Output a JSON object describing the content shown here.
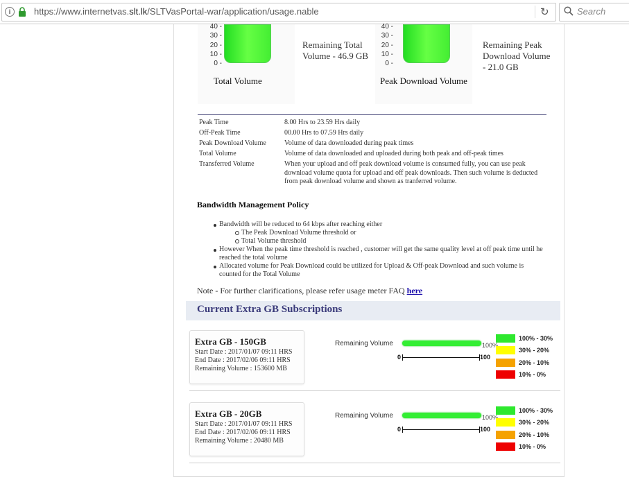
{
  "browser": {
    "url_prefix": "https://www.internetvas.",
    "url_domain": "slt.lk",
    "url_path": "/SLTVasPortal-war/application/usage.nable",
    "search_placeholder": "Search"
  },
  "gauges": [
    {
      "title": "Total Volume",
      "ticks": [
        "40 -",
        "30 -",
        "20 -",
        "10 -",
        "0 -"
      ],
      "remaining": "Remaining Total Volume - 46.9 GB"
    },
    {
      "title": "Peak Download Volume",
      "ticks": [
        "40 -",
        "30 -",
        "20 -",
        "10 -",
        "0 -"
      ],
      "remaining": "Remaining Peak Download Volume - 21.0 GB"
    }
  ],
  "definitions": [
    {
      "term": "Peak Time",
      "desc": "8.00 Hrs to 23.59 Hrs daily"
    },
    {
      "term": "Off-Peak Time",
      "desc": "00.00 Hrs to 07.59 Hrs daily"
    },
    {
      "term": "Peak Download Volume",
      "desc": "Volume of data downloaded during peak times"
    },
    {
      "term": "Total Volume",
      "desc": "Volume of data downloaded and uploaded during both peak and off-peak times"
    },
    {
      "term": "Transferred Volume",
      "desc": "When your upload and off peak download volume is consumed fully, you can use peak download volume quota for upload and off peak downloads. Then such volume is deducted from peak download volume and shown as tranferred volume."
    }
  ],
  "policy": {
    "title": "Bandwidth Management Policy",
    "b1": "Bandwidth will be reduced to 64 kbps after reaching either",
    "b1a": "The Peak Download Volume threshold or",
    "b1b": "Total Volume threshold",
    "b2": "However When the peak time threshold is reached , customer will get the same quality level at off peak time until he reached the total volume",
    "b3": "Allocated volume for Peak Download could be utilized for Upload & Off-peak Download and such volume is counted for the Total Volume"
  },
  "note": {
    "text": "Note - For further clarifications, please refer usage meter FAQ ",
    "link": "here"
  },
  "extra": {
    "heading": "Current Extra GB Subscriptions",
    "remaining_label": "Remaining Volume",
    "scale_min": "0",
    "scale_max": "100",
    "subs": [
      {
        "title": "Extra GB - 150GB",
        "start": "Start Date : 2017/01/07 09:11 HRS",
        "end": "End Date : 2017/02/06 09:11 HRS",
        "remaining": "Remaining Volume : 153600 MB",
        "percent": "100%",
        "level": 100
      },
      {
        "title": "Extra GB - 20GB",
        "start": "Start Date : 2017/01/07 09:11 HRS",
        "end": "End Date : 2017/02/06 09:11 HRS",
        "remaining": "Remaining Volume : 20480 MB",
        "percent": "100%",
        "level": 100
      }
    ],
    "legend": [
      {
        "label": "100% - 30%",
        "color": "#2ee82e"
      },
      {
        "label": "30% - 20%",
        "color": "#ffff00"
      },
      {
        "label": "20% - 10%",
        "color": "#f5a200"
      },
      {
        "label": "10% - 0%",
        "color": "#ee0000"
      }
    ]
  }
}
